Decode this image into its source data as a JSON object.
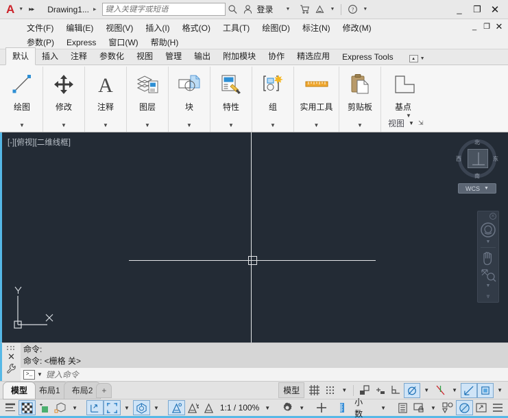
{
  "titlebar": {
    "app_logo": "autodesk-a-logo",
    "document_name": "Drawing1...",
    "search_placeholder": "键入关键字或短语",
    "login_label": "登录",
    "icons": [
      "search-icon",
      "account-icon",
      "cart-icon",
      "autodesk-icon",
      "help-icon"
    ],
    "window_buttons": {
      "minimize": "_",
      "maximize": "❐",
      "close": "✕"
    }
  },
  "menubar": {
    "row1": [
      "文件(F)",
      "编辑(E)",
      "视图(V)",
      "插入(I)",
      "格式(O)",
      "工具(T)",
      "绘图(D)",
      "标注(N)",
      "修改(M)"
    ],
    "row2": [
      "参数(P)",
      "Express",
      "窗口(W)",
      "帮助(H)"
    ],
    "mdi": {
      "minimize": "_",
      "restore": "❐",
      "close": "✕"
    }
  },
  "ribbon": {
    "tabs": [
      {
        "label": "默认",
        "active": true
      },
      {
        "label": "插入",
        "active": false
      },
      {
        "label": "注释",
        "active": false
      },
      {
        "label": "参数化",
        "active": false
      },
      {
        "label": "视图",
        "active": false
      },
      {
        "label": "管理",
        "active": false
      },
      {
        "label": "输出",
        "active": false
      },
      {
        "label": "附加模块",
        "active": false
      },
      {
        "label": "协作",
        "active": false
      },
      {
        "label": "精选应用",
        "active": false
      },
      {
        "label": "Express Tools",
        "active": false
      }
    ],
    "panels": [
      {
        "label": "绘图",
        "icon": "line-icon"
      },
      {
        "label": "修改",
        "icon": "move-arrows-icon"
      },
      {
        "label": "注释",
        "icon": "text-a-icon"
      },
      {
        "label": "图层",
        "icon": "layers-icon"
      },
      {
        "label": "块",
        "icon": "block-insert-icon"
      },
      {
        "label": "特性",
        "icon": "properties-brush-icon"
      },
      {
        "label": "组",
        "icon": "group-icon"
      },
      {
        "label": "实用工具",
        "icon": "ruler-icon"
      },
      {
        "label": "剪贴板",
        "icon": "clipboard-icon"
      },
      {
        "label": "基点",
        "icon": "basepoint-icon"
      }
    ],
    "view_label": "视图"
  },
  "canvas": {
    "viewport_label": "[-][俯视][二维线框]",
    "background_color": "#232b35",
    "crosshair_color": "#e4e6e8",
    "ucs": {
      "x_axis_label": "X",
      "y_axis_label": "Y"
    },
    "viewcube": {
      "north": "北",
      "south": "南",
      "east": "东",
      "west": "西",
      "wcs_label": "WCS"
    },
    "navbar_icons": [
      "steering-wheel-icon",
      "pan-hand-icon",
      "zoom-extents-icon",
      "orbit-icon"
    ]
  },
  "commandline": {
    "history": [
      "命令:",
      "命令:  <栅格 关>"
    ],
    "input_placeholder": "键入命令",
    "icons": [
      "grip-dots-icon",
      "close-icon",
      "wrench-icon",
      "command-prompt-icon"
    ]
  },
  "layout_tabs": [
    {
      "label": "模型",
      "active": true
    },
    {
      "label": "布局1",
      "active": false
    },
    {
      "label": "布局2",
      "active": false
    },
    {
      "label": "+",
      "active": false
    }
  ],
  "statusbar_top": {
    "model_button": "模型",
    "items": [
      {
        "name": "grid-display-icon",
        "on": false
      },
      {
        "name": "snap-mode-icon",
        "on": false
      },
      {
        "name": "snap-dropdown-icon",
        "on": false
      },
      {
        "name": "ortho-mode-icon",
        "on": false
      },
      {
        "name": "polar-tracking-icon",
        "on": false
      },
      {
        "name": "isometric-draft-icon",
        "on": false
      },
      {
        "name": "object-snap-icon",
        "on": true
      },
      {
        "name": "object-snap-dropdown-icon",
        "on": false
      },
      {
        "name": "object-snap-tracking-icon",
        "on": false
      },
      {
        "name": "osnap-track-dropdown-icon",
        "on": false
      },
      {
        "name": "ucs-icon",
        "on": true
      },
      {
        "name": "dynamic-input-icon",
        "on": true
      },
      {
        "name": "dyn-dropdown-icon",
        "on": false
      }
    ]
  },
  "statusbar_bottom": {
    "scale_text": "1:1 / 100%",
    "units_text": "小数",
    "items": [
      {
        "name": "lineweight-icon",
        "on": false
      },
      {
        "name": "transparency-icon",
        "on": true
      },
      {
        "name": "selection-cycling-icon",
        "on": false
      },
      {
        "name": "3d-object-snap-icon",
        "on": false
      },
      {
        "name": "3d-osnap-dropdown-icon",
        "on": false
      },
      {
        "name": "dynamic-ucs-icon",
        "on": true
      },
      {
        "name": "selection-filter-icon",
        "on": true
      },
      {
        "name": "sel-filter-dropdown-icon",
        "on": false
      },
      {
        "name": "gizmo-icon",
        "on": true
      },
      {
        "name": "gizmo-dropdown-icon",
        "on": false
      },
      {
        "name": "annotation-visibility-icon",
        "on": true
      },
      {
        "name": "autoscale-icon",
        "on": false
      },
      {
        "name": "annotation-scale-icon",
        "on": false
      },
      {
        "name": "workspace-gear-icon",
        "on": false
      },
      {
        "name": "workspace-dropdown-icon",
        "on": false
      },
      {
        "name": "hardware-accel-icon",
        "on": false
      },
      {
        "name": "units-icon",
        "on": false
      },
      {
        "name": "units-dropdown-icon",
        "on": false
      },
      {
        "name": "quick-properties-icon",
        "on": false
      },
      {
        "name": "lock-ui-icon",
        "on": false
      },
      {
        "name": "lock-dropdown-icon",
        "on": false
      },
      {
        "name": "isolate-objects-icon",
        "on": false
      },
      {
        "name": "graphics-perf-icon",
        "on": true
      },
      {
        "name": "clean-screen-icon",
        "on": false
      },
      {
        "name": "customization-icon",
        "on": false
      }
    ]
  }
}
